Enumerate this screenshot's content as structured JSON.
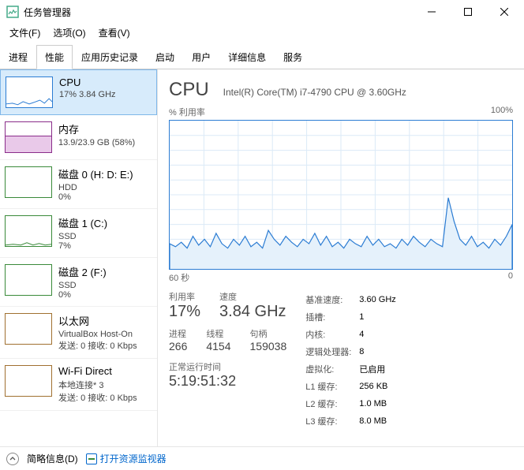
{
  "window": {
    "title": "任务管理器",
    "minimize": "−",
    "maximize": "□",
    "close": "×"
  },
  "menu": {
    "file": "文件(F)",
    "options": "选项(O)",
    "view": "查看(V)"
  },
  "tabs": [
    "进程",
    "性能",
    "应用历史记录",
    "启动",
    "用户",
    "详细信息",
    "服务"
  ],
  "sidebar": [
    {
      "title": "CPU",
      "sub": "17% 3.84 GHz"
    },
    {
      "title": "内存",
      "sub": "13.9/23.9 GB (58%)"
    },
    {
      "title": "磁盘 0 (H: D: E:)",
      "sub1": "HDD",
      "sub2": "0%"
    },
    {
      "title": "磁盘 1 (C:)",
      "sub1": "SSD",
      "sub2": "7%"
    },
    {
      "title": "磁盘 2 (F:)",
      "sub1": "SSD",
      "sub2": "0%"
    },
    {
      "title": "以太网",
      "sub1": "VirtualBox Host-On",
      "sub2": "发送: 0 接收: 0 Kbps"
    },
    {
      "title": "Wi-Fi Direct",
      "sub1": "本地连接* 3",
      "sub2": "发送: 0 接收: 0 Kbps"
    }
  ],
  "main": {
    "title": "CPU",
    "subtitle": "Intel(R) Core(TM) i7-4790 CPU @ 3.60GHz",
    "chart_top_left": "% 利用率",
    "chart_top_right": "100%",
    "chart_bot_left": "60 秒",
    "chart_bot_right": "0",
    "stats_left": {
      "util_label": "利用率",
      "util_val": "17%",
      "speed_label": "速度",
      "speed_val": "3.84 GHz",
      "proc_label": "进程",
      "proc_val": "266",
      "thread_label": "线程",
      "thread_val": "4154",
      "handle_label": "句柄",
      "handle_val": "159038",
      "uptime_label": "正常运行时间",
      "uptime_val": "5:19:51:32"
    },
    "stats_right": [
      {
        "k": "基准速度:",
        "v": "3.60 GHz"
      },
      {
        "k": "插槽:",
        "v": "1"
      },
      {
        "k": "内核:",
        "v": "4"
      },
      {
        "k": "逻辑处理器:",
        "v": "8"
      },
      {
        "k": "虚拟化:",
        "v": "已启用",
        "highlight": true
      },
      {
        "k": "L1 缓存:",
        "v": "256 KB"
      },
      {
        "k": "L2 缓存:",
        "v": "1.0 MB"
      },
      {
        "k": "L3 缓存:",
        "v": "8.0 MB"
      }
    ]
  },
  "footer": {
    "brief": "简略信息(D)",
    "resmon": "打开资源监视器"
  },
  "chart_data": {
    "type": "line",
    "title": "% 利用率",
    "xlabel": "60 秒",
    "ylabel": "%",
    "ylim": [
      0,
      100
    ],
    "x_range_seconds": [
      60,
      0
    ],
    "series": [
      {
        "name": "CPU 利用率",
        "values": [
          17,
          15,
          18,
          14,
          22,
          16,
          20,
          15,
          24,
          17,
          14,
          20,
          16,
          22,
          15,
          18,
          14,
          26,
          20,
          16,
          22,
          18,
          15,
          20,
          17,
          24,
          16,
          22,
          15,
          18,
          14,
          20,
          17,
          15,
          22,
          16,
          20,
          15,
          17,
          14,
          20,
          16,
          22,
          18,
          15,
          20,
          17,
          15,
          48,
          32,
          20,
          16,
          22,
          15,
          18,
          14,
          20,
          16,
          22,
          30
        ]
      }
    ]
  }
}
